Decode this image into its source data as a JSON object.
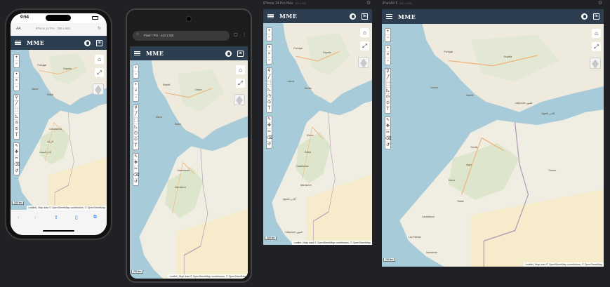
{
  "app": {
    "brand": "MME"
  },
  "devices": {
    "iphone14": {
      "time": "9:54",
      "text_size": "AA",
      "url": "iPhone 14 Pro · 390 x 844",
      "map_labels": [
        "España",
        "Portugal",
        "Maroc",
        "Rabat",
        "Casablanca",
        "الرباط",
        "الدار البيضاء"
      ]
    },
    "pixel7": {
      "url": "Pixel 7 Pro · 412 x 915",
      "map_labels": [
        "Lisboa",
        "Madrid",
        "Maroc",
        "Rabat",
        "Casablanca",
        "Marrakech"
      ]
    },
    "iphone14promax": {
      "label": "iPhone 14 Pro Max",
      "size": "430 x 932",
      "map_labels": [
        "España",
        "Portugal",
        "Lisboa",
        "Sevilla",
        "Maroc",
        "Rabat",
        "Casablanca",
        "Marrakech",
        "Agadir أكادير",
        "Laâyoune العيون"
      ]
    },
    "ipadair": {
      "label": "iPad Air 5",
      "size": "820 x 1180",
      "map_labels": [
        "España",
        "Portugal",
        "Lisboa",
        "Madrid",
        "Sevilla",
        "Alger",
        "Maroc",
        "Rabat",
        "Casablanca",
        "Marrakech",
        "Agadir أكادير",
        "Laâyoune العيون",
        "Tindouf",
        "Las Palmas"
      ]
    }
  },
  "map": {
    "zoom_in": "+",
    "zoom_out": "−",
    "home_icon": "home-icon",
    "fullscreen_icon": "fullscreen-icon",
    "layers_icon": "layers-icon",
    "draw_tools": [
      "•",
      "×",
      "−",
      "⚲",
      "╱",
      "⬚",
      "◺",
      "◷",
      "⊙",
      "T",
      "⇖",
      "✥",
      "✂",
      "⌫",
      "↺"
    ],
    "attribution": "Leaflet | Map data © OpenStreetMap contributors, © OpenStreetMap",
    "scale": "200 km"
  },
  "colors": {
    "navbar": "#2c3e50",
    "sea": "#a7cbd8",
    "land": "#eeeade",
    "background": "#202124"
  }
}
